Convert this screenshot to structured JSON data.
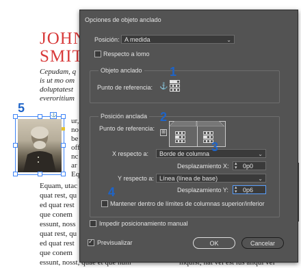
{
  "document": {
    "heading_line1": "JOHN",
    "heading_line2": "SMIT",
    "intro_lines": [
      "Cepudam, q",
      "is ut mo om",
      "doluptatest",
      "everoritium"
    ],
    "wrap_lines": [
      "ur,",
      "no",
      "be",
      "off",
      "nc",
      "ar",
      "Eq"
    ],
    "body_lines": [
      "Equam, utac",
      "quat rest, qu",
      "ed quat rest",
      "que conem",
      "essunt, noss",
      "quat rest, qu",
      "ed quat rest",
      "que conem",
      "essunt, nosst, quae et que num"
    ],
    "right_footer_line": "mquist, nat vel est ius aliqui vel"
  },
  "callouts": {
    "one": "1",
    "two": "2",
    "three": "3",
    "four": "4",
    "five": "5"
  },
  "dialog": {
    "title": "Opciones de objeto anclado",
    "position_label": "Posición:",
    "position_value": "A medida",
    "spine_label": "Respecto a lomo",
    "anchored_object_group": "Objeto anclado",
    "reference_point_label": "Punto de referencia:",
    "anchored_position_group": "Posición anclada",
    "anchored_reference_label": "Punto de referencia:",
    "x_relative_label": "X respecto a:",
    "x_relative_value": "Borde de columna",
    "x_offset_label": "Desplazamiento X:",
    "x_offset_value": "0p0",
    "y_relative_label": "Y respecto a:",
    "y_relative_value": "Línea (línea de base)",
    "y_offset_label": "Desplazamiento Y:",
    "y_offset_value": "0p6",
    "keep_within_label": "Mantener dentro de límites de columnas superior/inferior",
    "prevent_manual_label": "Impedir posicionamiento manual",
    "preview_label": "Previsualizar",
    "ok_label": "OK",
    "cancel_label": "Cancelar"
  },
  "state": {
    "spine_checked": false,
    "keep_within_checked": false,
    "prevent_manual_checked": false,
    "preview_checked": true
  },
  "colors": {
    "heading": "#d83a3a",
    "callout": "#1e64c8",
    "dialog_bg": "#535353"
  }
}
